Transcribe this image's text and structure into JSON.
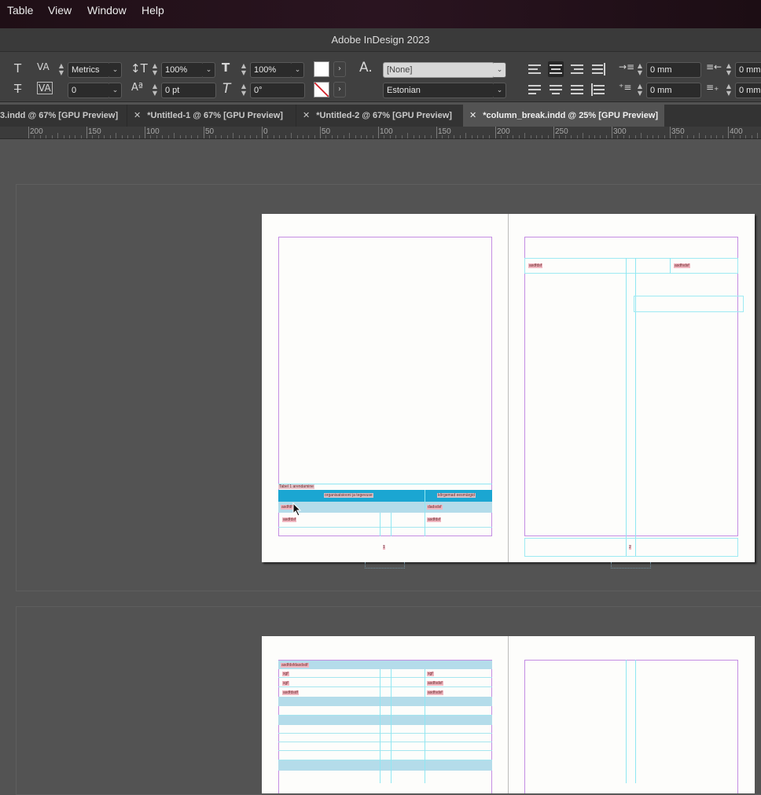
{
  "menu": [
    "Table",
    "View",
    "Window",
    "Help"
  ],
  "app_title": "Adobe InDesign 2023",
  "control": {
    "kerning": "Metrics",
    "tracking": "0",
    "vertical_scale": "100%",
    "baseline_shift": "0 pt",
    "horizontal_scale": "100%",
    "skew": "0°",
    "char_style": "[None]",
    "language": "Estonian",
    "left_indent": "0 mm",
    "first_line_indent": "0 mm",
    "right_indent": "0 mm",
    "last_line_indent": "0 mm"
  },
  "tabs": [
    {
      "label": "3.indd @ 67% [GPU Preview]",
      "active": false
    },
    {
      "label": "*Untitled-1 @ 67% [GPU Preview]",
      "active": false
    },
    {
      "label": "*Untitled-2 @ 67% [GPU Preview]",
      "active": false
    },
    {
      "label": "*column_break.indd @ 25% [GPU Preview]",
      "active": true
    }
  ],
  "ruler": {
    "labels": [
      "200",
      "150",
      "100",
      "50",
      "0",
      "50",
      "100",
      "150",
      "200",
      "250",
      "300",
      "350",
      "400"
    ]
  },
  "spread1": {
    "left_page": {
      "caption_label": "Tabel 1",
      "caption_text": "arendamine",
      "header_cells": [
        "organisatsiooni ja tegevuse",
        "kõrgemad eesmärgid"
      ],
      "row1": [
        "asdfdf",
        "dadsdsf"
      ],
      "row2": [
        "asdfdsf",
        "asdfdsf"
      ],
      "page_number": "1"
    },
    "right_page": {
      "row1": [
        "asdfdsf",
        "asdfsdsf"
      ],
      "page_number": "2"
    }
  },
  "spread2": {
    "left_page": {
      "header_text": "asdfdsfdasdsdf",
      "rows": [
        [
          "sgf",
          "sgf"
        ],
        [
          "sgf",
          "asdfsdsf"
        ],
        [
          "asdfdsdf",
          "asdfsdsf"
        ]
      ]
    }
  },
  "colors": {
    "table_header": "#1ba6d2",
    "table_row": "#b4dcea",
    "margin_guide": "#c48de3",
    "column_guide": "#8fe7f2"
  }
}
